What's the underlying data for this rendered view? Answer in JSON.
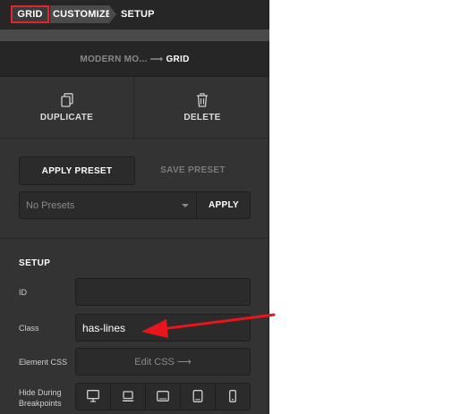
{
  "breadcrumbs": {
    "grid": "GRID",
    "customize": "CUSTOMIZE",
    "setup": "SETUP"
  },
  "path": {
    "parent": "MODERN MO...",
    "separator": "⟶",
    "current": "GRID"
  },
  "actions": {
    "duplicate": "DUPLICATE",
    "delete": "DELETE"
  },
  "presets": {
    "apply_tab": "APPLY PRESET",
    "save_tab": "SAVE PRESET",
    "select_value": "No Presets",
    "apply_button": "APPLY"
  },
  "setup": {
    "title": "SETUP",
    "id_label": "ID",
    "id_value": "",
    "class_label": "Class",
    "class_value": "has-lines",
    "css_label": "Element CSS",
    "css_button": "Edit CSS ⟶",
    "breakpoints_label_1": "Hide During",
    "breakpoints_label_2": "Breakpoints",
    "breakpoints": [
      "desktop-icon",
      "laptop-icon",
      "tablet-landscape-icon",
      "tablet-portrait-icon",
      "mobile-icon"
    ]
  },
  "colors": {
    "highlight": "#e2262a",
    "panel": "#333333",
    "field": "#2b2b2b"
  }
}
